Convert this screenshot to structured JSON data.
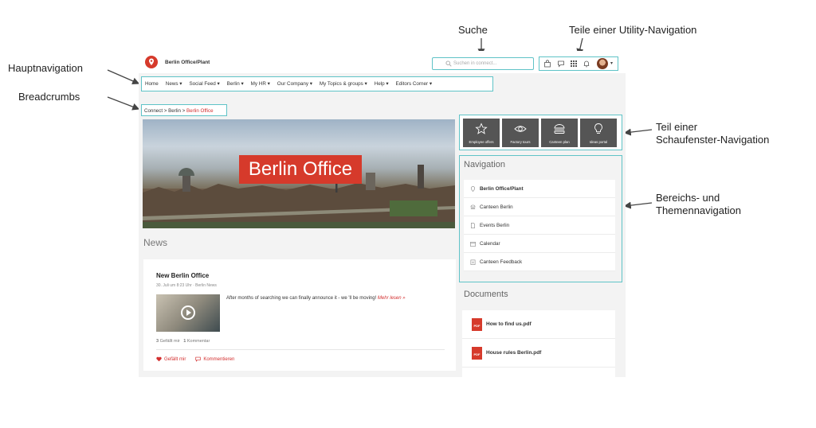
{
  "annotations": {
    "suche": "Suche",
    "utility": "Teile einer Utility-Navigation",
    "hauptnavigation": "Hauptnavigation",
    "breadcrumbs": "Breadcrumbs",
    "schaufenster_1": "Teil einer",
    "schaufenster_2": "Schaufenster-Navigation",
    "bereichs_1": "Bereichs- und",
    "bereichs_2": "Themennavigation"
  },
  "header": {
    "site_name": "Berlin Office/Plant",
    "search_placeholder": "Suchen in connect..."
  },
  "main_nav": [
    "Home",
    "News ▾",
    "Social Feed ▾",
    "Berlin ▾",
    "My HR ▾",
    "Our Company ▾",
    "My Topics & groups ▾",
    "Help ▾",
    "Editors Corner ▾"
  ],
  "breadcrumb": {
    "path": "Connect > Berlin > ",
    "current": "Berlin Office"
  },
  "hero": {
    "title": "Berlin Office"
  },
  "news": {
    "heading": "News",
    "post": {
      "title": "New Berlin Office",
      "meta": "30. Juli um 8:23 Uhr · Berlin News",
      "text": "After months of searching we can finally announce it - we 'll be moving! ",
      "more": "Mehr lesen »",
      "likes_count": "3",
      "likes_label": "Gefällt mir",
      "comments_count": "1",
      "comments_label": "Kommentar",
      "like_action": "Gefällt mir",
      "comment_action": "Kommentieren"
    }
  },
  "showcase": [
    {
      "label": "Employee offers",
      "icon": "star-icon"
    },
    {
      "label": "Factory tours",
      "icon": "eye-icon"
    },
    {
      "label": "Canteen plan",
      "icon": "burger-icon"
    },
    {
      "label": "Ideas portal",
      "icon": "lightbulb-icon"
    }
  ],
  "navigation": {
    "heading": "Navigation",
    "items": [
      {
        "label": "Berlin Office/Plant",
        "icon": "pin-icon"
      },
      {
        "label": "Canteen Berlin",
        "icon": "burger-icon"
      },
      {
        "label": "Events Berlin",
        "icon": "document-icon"
      },
      {
        "label": "Calendar",
        "icon": "calendar-icon"
      },
      {
        "label": "Canteen Feedback",
        "icon": "clipboard-icon"
      }
    ]
  },
  "documents": {
    "heading": "Documents",
    "items": [
      {
        "name": "How to find us.pdf",
        "type": "PDF"
      },
      {
        "name": "House rules Berlin.pdf",
        "type": "PDF"
      }
    ]
  },
  "colors": {
    "accent": "#d63a2b",
    "highlight_box": "#5fc3c7",
    "tile": "#555555"
  }
}
